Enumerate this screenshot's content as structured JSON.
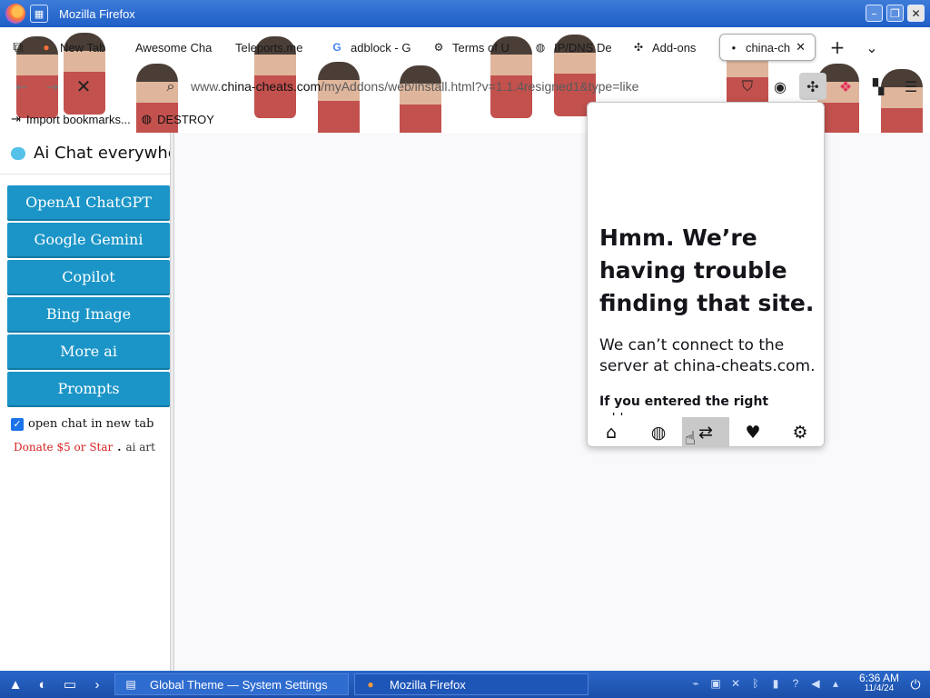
{
  "window": {
    "title": "Mozilla Firefox"
  },
  "tabs": [
    {
      "label": "New Tab",
      "icon": "firefox-icon"
    },
    {
      "label": "Awesome Cha",
      "icon": ""
    },
    {
      "label": "Teleports.me",
      "icon": ""
    },
    {
      "label": "adblock - G",
      "icon": "google-icon"
    },
    {
      "label": "Terms of U",
      "icon": "gear-icon"
    },
    {
      "label": "IP/DNS De",
      "icon": "globe-icon"
    },
    {
      "label": "Add-ons",
      "icon": "puzzle-icon"
    },
    {
      "label": "china-ch",
      "icon": "dot-icon",
      "active": true
    }
  ],
  "url": {
    "prefix": "www.",
    "host": "china-cheats.com",
    "path": "/myAddons/web/install.html?v=1.1.4resigned1&type=like"
  },
  "bookmarks": [
    {
      "label": "Import bookmarks...",
      "icon": "import-icon"
    },
    {
      "label": "DESTROY",
      "icon": "globe-icon"
    }
  ],
  "sidebar": {
    "title": "Ai Chat everywhere",
    "buttons": [
      "OpenAI ChatGPT",
      "Google Gemini",
      "Copilot",
      "Bing Image",
      "More ai",
      "Prompts"
    ],
    "checkbox_label": "open chat in new tab",
    "checkbox_checked": true,
    "donate_link": "Donate $5 or Star",
    "separator": ".",
    "art_link": "ai art"
  },
  "popup": {
    "heading": "Hmm. We’re having trouble finding that site.",
    "message": "We can’t connect to the server at china-cheats.com.",
    "hint": "If you entered the right",
    "hint_cut": "address, you can:",
    "nav": [
      "home-icon",
      "globe-icon",
      "handshake-icon",
      "heart-icon",
      "gear-icon"
    ],
    "nav_active_index": 2
  },
  "taskbar": {
    "tasks": [
      {
        "label": "Global Theme — System Settings",
        "icon": "settings-icon"
      },
      {
        "label": "Mozilla Firefox",
        "icon": "firefox-icon"
      }
    ],
    "time": "6:36 AM",
    "date": "11/4/24"
  },
  "colors": {
    "sidebar_button": "#1b95c7",
    "titlebar": "#2a66c9",
    "donate": "#d62020"
  }
}
